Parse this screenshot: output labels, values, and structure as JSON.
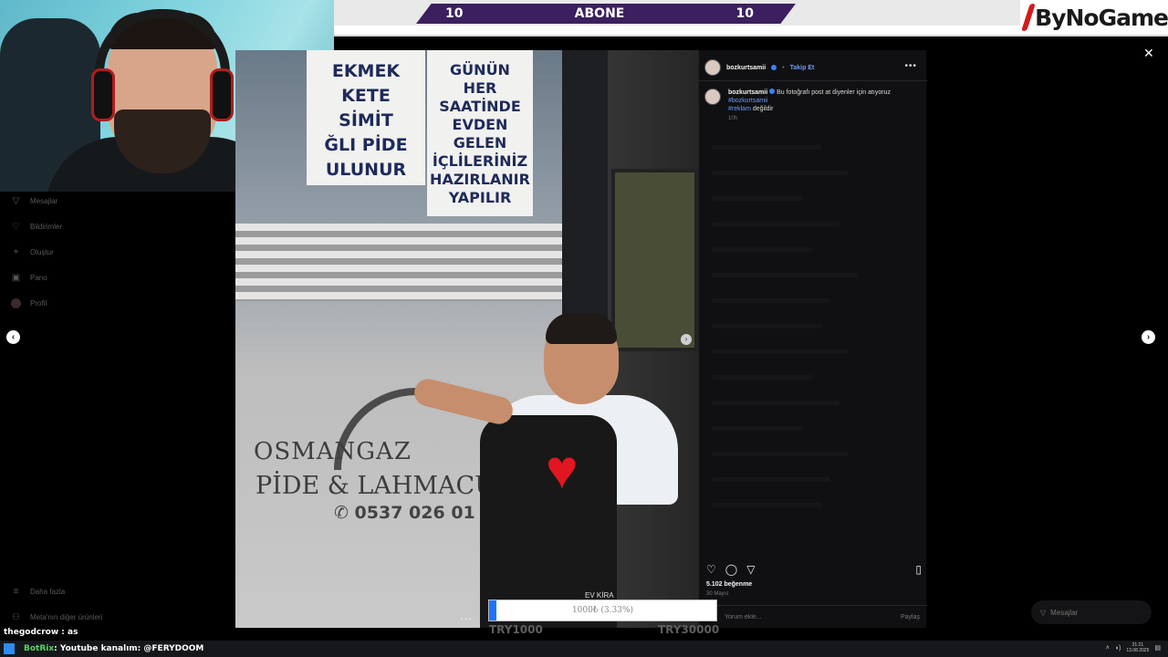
{
  "stream": {
    "sub_goal": {
      "left": "10",
      "label": "ABONE",
      "right": "10"
    },
    "brand": "ByNoGame",
    "donation_goal": {
      "label": "1000₺ (3.33%)",
      "progress_fraction": 0.0333,
      "left_text": "TRY1000",
      "right_text": "TRY30000"
    },
    "chat": {
      "user": "thegodcrow",
      "message": "as"
    },
    "taskbar_message": {
      "bot": "BotRix",
      "text": "Youtube kanalım: @FERYDOOM"
    },
    "clock": {
      "time": "21:21",
      "date": "13.08.2025"
    }
  },
  "sidebar": {
    "items": [
      {
        "label": "Mesajlar",
        "icon": "send-icon"
      },
      {
        "label": "Bildirimler",
        "icon": "heart-icon"
      },
      {
        "label": "Oluştur",
        "icon": "plus-icon"
      },
      {
        "label": "Pano",
        "icon": "dashboard-icon"
      },
      {
        "label": "Profil",
        "icon": "profile-avatar"
      }
    ],
    "bottom": [
      {
        "label": "Daha fazla",
        "icon": "menu-icon"
      },
      {
        "label": "Meta'nın diğer ürünleri",
        "icon": "meta-icon"
      }
    ]
  },
  "photo": {
    "sign1": [
      "EKMEK",
      "KETE",
      "SİMİT",
      "ĞLI PİDE",
      "ULUNUR"
    ],
    "sign2": [
      "GÜNÜN",
      "HER",
      "SAATİNDE",
      "EVDEN",
      "GELEN",
      "İÇLİLERİNİZ",
      "HAZIRLANIR",
      "YAPILIR"
    ],
    "shop_name": "OSMANGAZ",
    "shop_sub": "PİDE & LAHMACU",
    "phone": "0537 026 01 81",
    "apron_text": "EV KİRA"
  },
  "post": {
    "username": "bozkurtsamii",
    "follow_label": "Takip Et",
    "caption": "Bu fotoğrafı post at diyenler için atıyoruz",
    "hashtag1": "#bozkurtsamii",
    "hashtag2": "#reklam",
    "caption_tail": "değildir",
    "time": "10h",
    "likes": "5.102 beğenme",
    "date": "30 Mayıs",
    "comment_placeholder": "Yorum ekle...",
    "share_label": "Paylaş"
  },
  "messages_pill": {
    "label": "Mesajlar"
  },
  "colors": {
    "sub_banner": "#3b1f5e",
    "brand_red": "#d21b1b",
    "link_blue": "#6d9cf5",
    "goal_fill": "#1e74ff"
  }
}
